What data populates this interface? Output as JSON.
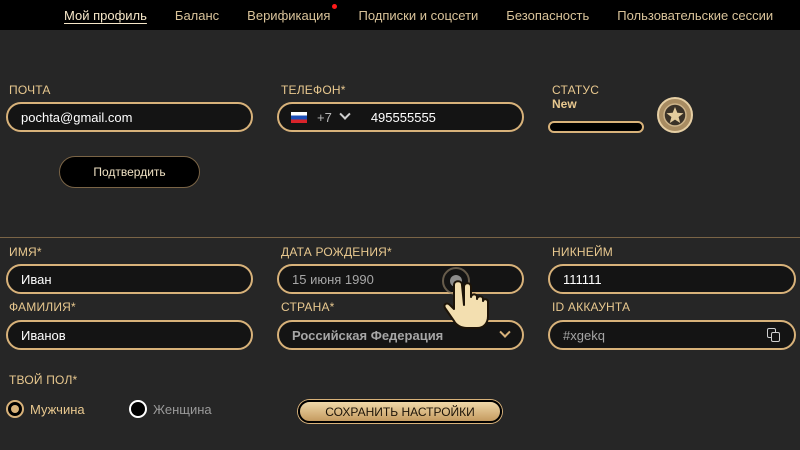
{
  "nav": {
    "tabs": [
      {
        "label": "Мой профиль",
        "active": true
      },
      {
        "label": "Баланс"
      },
      {
        "label": "Верификация",
        "notify": true
      },
      {
        "label": "Подписки и соцсети"
      },
      {
        "label": "Безопасность"
      },
      {
        "label": "Пользовательские сессии"
      }
    ]
  },
  "contact": {
    "email_label": "ПОЧТА",
    "email_value": "pochta@gmail.com",
    "phone_label": "ТЕЛЕФОН*",
    "phone_code": "+7",
    "phone_number": "495555555",
    "confirm_button": "Подтвердить"
  },
  "status": {
    "label": "СТАТУС",
    "value": "New",
    "progress": 0
  },
  "profile": {
    "first_name_label": "ИМЯ*",
    "first_name": "Иван",
    "last_name_label": "ФАМИЛИЯ*",
    "last_name": "Иванов",
    "birth_label": "ДАТА РОЖДЕНИЯ*",
    "birth_value": "15 июня 1990",
    "country_label": "СТРАНА*",
    "country_value": "Российская Федерация",
    "nickname_label": "НИКНЕЙМ",
    "nickname": "111111",
    "account_id_label": "ID АККАУНТА",
    "account_id": "#xgekq",
    "gender_label": "ТВОЙ ПОЛ*",
    "gender_male": "Мужчина",
    "gender_female": "Женщина",
    "save_button": "СОХРАНИТЬ НАСТРОЙКИ"
  },
  "icons": {
    "flag": "russia-flag-icon",
    "phone_dropdown": "chevron-down-icon",
    "status_badge": "star-medal-icon",
    "country_dropdown": "chevron-down-icon",
    "copy": "copy-icon",
    "cursor": "hand-pointer-icon"
  },
  "colors": {
    "accent": "#d8b27a",
    "background": "#262626",
    "nav_background": "#000000"
  }
}
